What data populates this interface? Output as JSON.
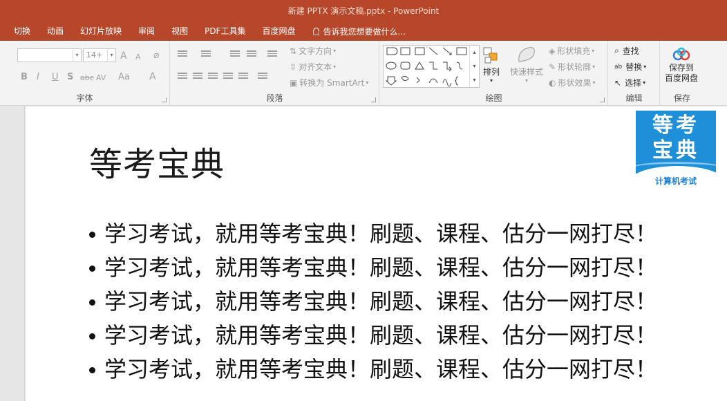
{
  "window": {
    "title": "新建 PPTX 演示文稿.pptx - PowerPoint"
  },
  "ribbon_tabs": [
    "切换",
    "动画",
    "幻灯片放映",
    "审阅",
    "视图",
    "PDF工具集",
    "百度网盘"
  ],
  "tell_me": "告诉我您想要做什么...",
  "font_group": {
    "label": "字体",
    "font_name_value": "",
    "font_size_value": "14+",
    "grow_label": "A",
    "shrink_label": "A",
    "bold": "B",
    "italic": "I",
    "underline": "U",
    "shadow": "S",
    "strike": "abc",
    "spacing": "AV",
    "case": "Aa",
    "color": "A"
  },
  "paragraph_group": {
    "label": "段落",
    "text_direction": "文字方向",
    "align_text": "对齐文本",
    "smartart": "转换为 SmartArt"
  },
  "drawing_group": {
    "label": "绘图",
    "arrange": "排列",
    "quick_styles": "快速样式",
    "shape_fill": "形状填充",
    "shape_outline": "形状轮廓",
    "shape_effects": "形状效果"
  },
  "editing_group": {
    "label": "编辑",
    "find": "查找",
    "replace": "替换",
    "select": "选择"
  },
  "save_group": {
    "label": "保存",
    "save_line1": "保存到",
    "save_line2": "百度网盘"
  },
  "slide": {
    "title": "等考宝典",
    "bullets": [
      "学习考试，就用等考宝典！刷题、课程、估分一网打尽！",
      "学习考试，就用等考宝典！刷题、课程、估分一网打尽！",
      "学习考试，就用等考宝典！刷题、课程、估分一网打尽！",
      "学习考试，就用等考宝典！刷题、课程、估分一网打尽！",
      "学习考试，就用等考宝典！刷题、课程、估分一网打尽！"
    ],
    "logo_line1": "等考",
    "logo_line2": "宝典",
    "logo_caption": "计算机考试"
  },
  "colors": {
    "accent": "#b7472a",
    "logo_blue": "#1e8fd8"
  }
}
